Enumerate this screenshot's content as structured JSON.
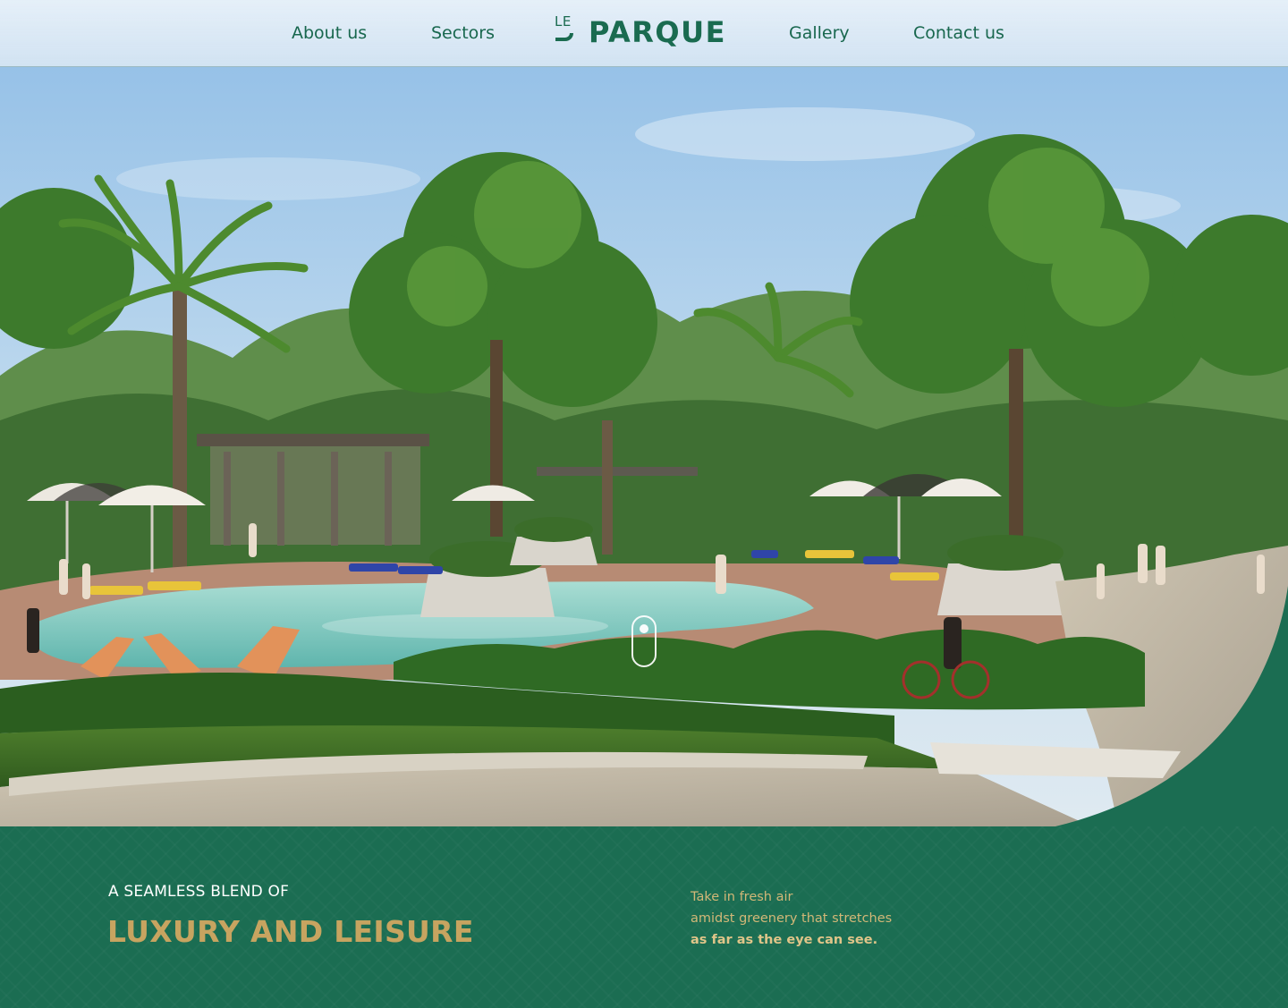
{
  "nav": {
    "about": "About us",
    "sectors": "Sectors",
    "gallery": "Gallery",
    "contact": "Contact us"
  },
  "logo": {
    "small": "LE",
    "word": "PARQUE"
  },
  "hero": {
    "image": "resort-pool-garden-render",
    "scroll_icon": "scroll-mouse-icon"
  },
  "intro": {
    "eyebrow": "A SEAMLESS BLEND OF",
    "headline": "LUXURY AND LEISURE",
    "tagline_1": "Take in fresh air",
    "tagline_2": "amidst greenery that stretches",
    "tagline_3": "as far as the eye can see."
  },
  "colors": {
    "brand_green": "#1b6d52",
    "gold": "#c7a460",
    "nav_text": "#18674e"
  }
}
